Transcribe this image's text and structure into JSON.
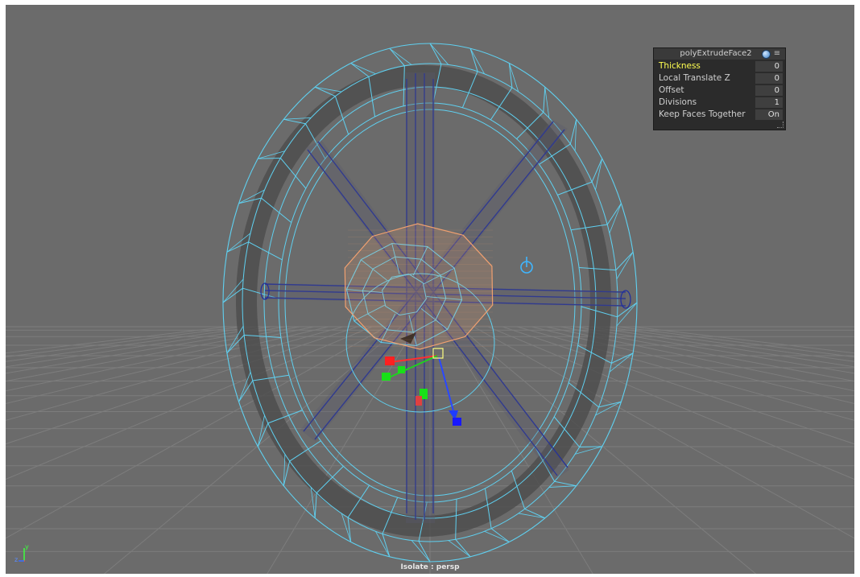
{
  "hud": {
    "title": "polyExtrudeFace2",
    "rows": [
      {
        "label": "Thickness",
        "value": "0",
        "active": true
      },
      {
        "label": "Local Translate Z",
        "value": "0",
        "active": false
      },
      {
        "label": "Offset",
        "value": "0",
        "active": false
      },
      {
        "label": "Divisions",
        "value": "1",
        "active": false
      },
      {
        "label": "Keep Faces Together",
        "value": "On",
        "active": false
      }
    ]
  },
  "status": {
    "text": "Isolate : persp"
  },
  "axis_labels": {
    "y": "y",
    "z": "z"
  },
  "colors": {
    "viewport_bg": "#6b6b6b",
    "grid": "#7d7d7d",
    "wireframe": "#5fd0f0",
    "selection_wire": "#1f2d9e",
    "selected_faces": "#f0a070",
    "pivot_icon": "#3fb6ff",
    "manip_x": "#ff2020",
    "manip_y": "#18e018",
    "manip_z": "#1818ff"
  }
}
